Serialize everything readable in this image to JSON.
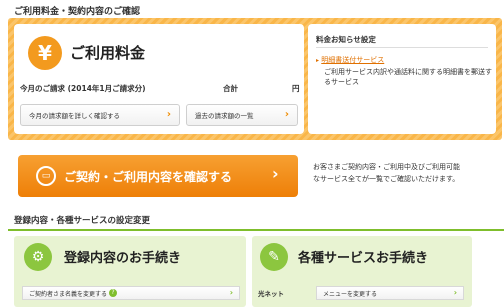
{
  "header": {
    "title": "ご利用料金・契約内容のご確認"
  },
  "fee_card": {
    "icon": "yen-icon",
    "icon_glyph": "¥",
    "title": "ご利用料金",
    "billing_label": "今月のご請求 (2014年1月ご請求分)",
    "total_label": "合計",
    "unit": "円",
    "detail_button": "今月の請求額を詳しく確認する",
    "history_button": "過去の請求額の一覧"
  },
  "notice_card": {
    "title": "料金お知らせ設定",
    "link": "明細書送付サービス",
    "description_line1": "ご利用サービス内訳や通話料に関する明細書を郵送す",
    "description_line2": "るサービス"
  },
  "contract_button": {
    "label": "ご契約・ご利用内容を確認する",
    "icon": "book-icon"
  },
  "contract_description": {
    "line1": "お客さまご契約内容・ご利用中及びご利用可能",
    "line2": "なサービス全てが一覧でご確認いただけます。"
  },
  "settings_section": {
    "title": "登録内容・各種サービスの設定変更"
  },
  "registration": {
    "icon": "gear-icon",
    "title": "登録内容のお手続き",
    "row_label": "ご契約者さま名義を変更する"
  },
  "services": {
    "icon": "pencil-icon",
    "title": "各種サービスお手続き",
    "row_category": "光ネット",
    "row_label": "メニューを変更する"
  },
  "colors": {
    "orange": "#f39a1e",
    "green": "#8cc63f"
  }
}
